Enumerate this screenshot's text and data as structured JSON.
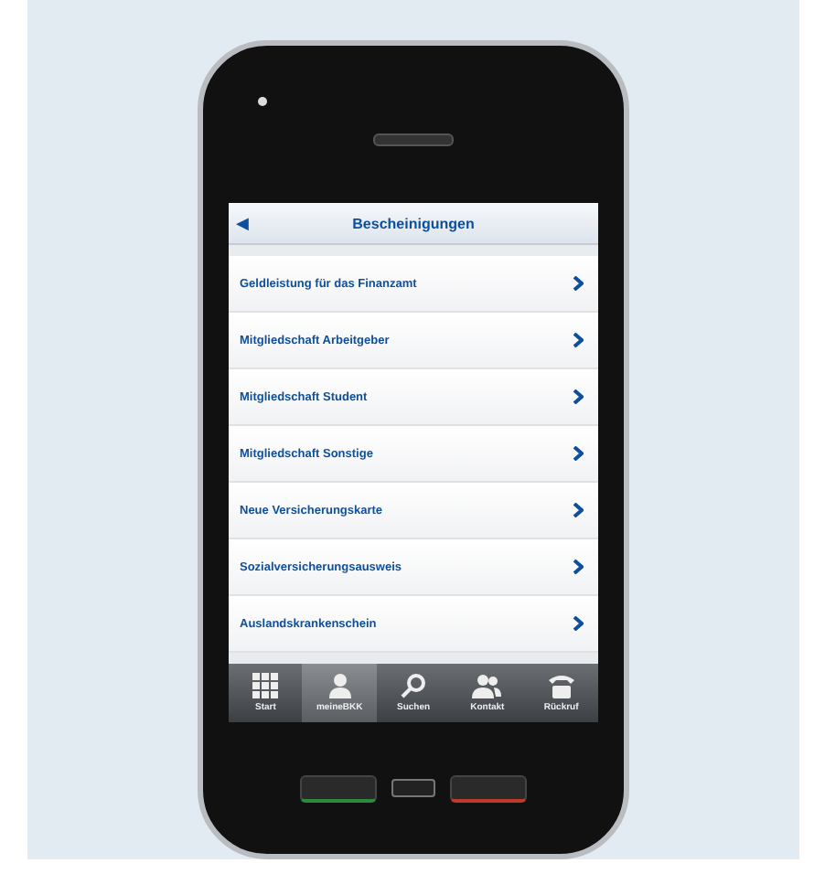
{
  "nav_bar": {
    "back": "◀",
    "title": "Bescheinigungen"
  },
  "items": [
    {
      "label": "Geldleistung für das Finanzamt"
    },
    {
      "label": "Mitgliedschaft Arbeitgeber"
    },
    {
      "label": "Mitgliedschaft Student"
    },
    {
      "label": "Mitgliedschaft Sonstige"
    },
    {
      "label": "Neue Versicherungskarte"
    },
    {
      "label": "Sozialversicherungsausweis"
    },
    {
      "label": "Auslandskrankenschein"
    }
  ],
  "tab_bar": [
    {
      "kind": "grid",
      "label": "Start",
      "selected": false
    },
    {
      "kind": "person",
      "label": "meineBKK",
      "selected": true
    },
    {
      "kind": "search",
      "label": "Suchen",
      "selected": false
    },
    {
      "kind": "people",
      "label": "Kontakt",
      "selected": false
    },
    {
      "kind": "phone",
      "label": "Rückruf",
      "selected": false
    }
  ]
}
